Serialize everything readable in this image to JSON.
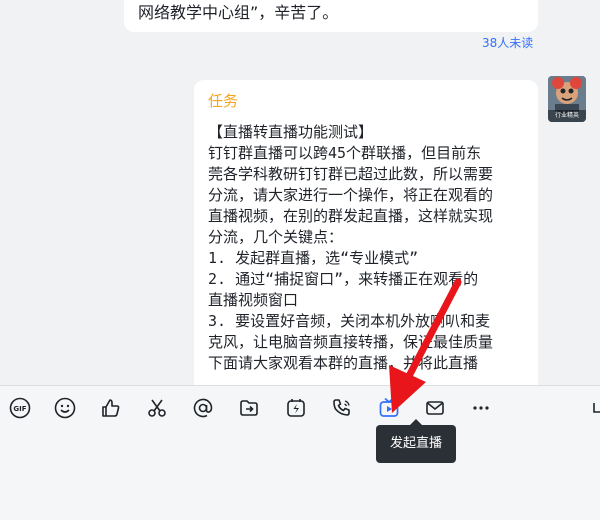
{
  "chat": {
    "prev_message": "网络教学中心组”，辛苦了。",
    "read_status": "38人未读",
    "task": {
      "title": "任务",
      "body": "【直播转直播功能测试】\n钉钉群直播可以跨45个群联播，但目前东\n莞各学科教研钉钉群已超过此数，所以需要\n分流，请大家进行一个操作，将正在观看的\n直播视频，在别的群发起直播，这样就实现\n分流，几个关键点：\n1. 发起群直播，选“专业模式”\n2. 通过“捕捉窗口”，来转播正在观看的\n直播视频窗口\n3. 要设置好音频，关闭本机外放喇叭和麦\n克风，让电脑音频直接转播，保证最佳质量\n下面请大家观看本群的直播，并将此直播"
    },
    "avatar_tag": "行业精英"
  },
  "toolbar": {
    "items": [
      "gif-icon",
      "emoji-icon",
      "thumbs-up-icon",
      "scissors-icon",
      "at-icon",
      "forward-icon",
      "flash-icon",
      "call-icon",
      "live-stream-icon",
      "mail-icon",
      "more-icon"
    ],
    "gif_label": "GIF",
    "tooltip": "发起直播"
  },
  "colors": {
    "accent": "#3370ff",
    "task_title": "#f5a623",
    "annotation_arrow": "#e8151b"
  }
}
